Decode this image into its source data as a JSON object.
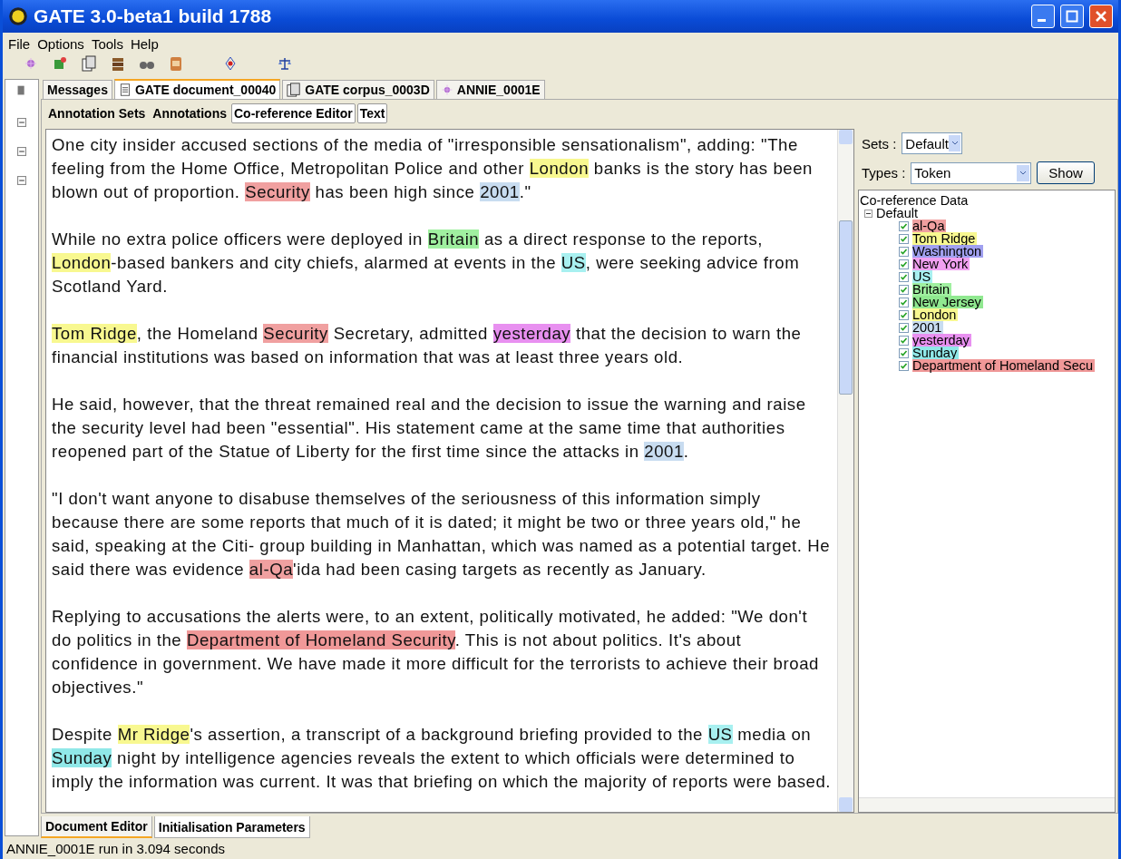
{
  "window": {
    "title": "GATE 3.0-beta1 build 1788"
  },
  "menu": [
    "File",
    "Options",
    "Tools",
    "Help"
  ],
  "resource_tabs": [
    {
      "label": "Messages",
      "kind": "plain",
      "selected": false
    },
    {
      "label": "GATE document_00040",
      "kind": "document",
      "selected": true
    },
    {
      "label": "GATE corpus_0003D",
      "kind": "corpus",
      "selected": false
    },
    {
      "label": "ANNIE_0001E",
      "kind": "application",
      "selected": false
    }
  ],
  "view_buttons": [
    {
      "label": "Annotation Sets",
      "selected": false
    },
    {
      "label": "Annotations",
      "selected": false
    },
    {
      "label": "Co-reference Editor",
      "selected": true
    },
    {
      "label": "Text",
      "selected": true
    }
  ],
  "document": {
    "paragraphs": [
      [
        {
          "text": "One city insider accused sections of the media of \"irresponsible sensationalism\", adding: \"The feeling from the Home Office, Metropolitan Police and other "
        },
        {
          "text": "London",
          "color": "#f8f890"
        },
        {
          "text": " banks is the story has been blown out of proportion. "
        },
        {
          "text": "Security",
          "color": "#f0a0a0"
        },
        {
          "text": " has been high since "
        },
        {
          "text": "2001",
          "color": "#c8dcf0"
        },
        {
          "text": ".\""
        }
      ],
      [
        {
          "text": "While no extra police officers were deployed in "
        },
        {
          "text": "Britain",
          "color": "#a0f0a0"
        },
        {
          "text": " as a direct response to the reports, "
        },
        {
          "text": "London",
          "color": "#f8f890"
        },
        {
          "text": "-based bankers and city chiefs, alarmed at events in the "
        },
        {
          "text": "US",
          "color": "#a8f0f0"
        },
        {
          "text": ", were seeking advice from Scotland Yard."
        }
      ],
      [
        {
          "text": "Tom Ridge",
          "color": "#f8f890"
        },
        {
          "text": ", the Homeland "
        },
        {
          "text": "Security",
          "color": "#f0a0a0"
        },
        {
          "text": " Secretary, admitted "
        },
        {
          "text": "yesterday",
          "color": "#e890f0"
        },
        {
          "text": " that the decision to warn the financial institutions was based on information that was at least three years old."
        }
      ],
      [
        {
          "text": "He said, however, that the threat remained real and the decision to issue the warning and raise the security level had been \"essential\". His statement came at the same time that authorities reopened part of the Statue of Liberty for the first time since the attacks in "
        },
        {
          "text": "2001",
          "color": "#c8dcf0"
        },
        {
          "text": "."
        }
      ],
      [
        {
          "text": "\"I don't want anyone to disabuse themselves of the seriousness of this information simply because there are some reports that much of it is dated; it might be two or three years old,\" he said, speaking at the Citi- group building in Manhattan, which was named as a potential target. He said there was evidence "
        },
        {
          "text": "al-Qa",
          "color": "#f0a0a0"
        },
        {
          "text": "'ida had been casing targets as recently as January."
        }
      ],
      [
        {
          "text": "Replying to accusations the alerts were, to an extent, politically motivated, he added: \"We don't do politics in the "
        },
        {
          "text": "Department of Homeland Security",
          "color": "#f09898"
        },
        {
          "text": ". This is not about politics. It's about confidence in government. We have made it more difficult for the terrorists to achieve their broad objectives.\""
        }
      ],
      [
        {
          "text": "Despite "
        },
        {
          "text": "Mr Ridge",
          "color": "#f8f890"
        },
        {
          "text": "'s assertion, a transcript of a background briefing provided to the "
        },
        {
          "text": "US",
          "color": "#a8f0f0"
        },
        {
          "text": " media on "
        },
        {
          "text": "Sunday",
          "color": "#90e8e8"
        },
        {
          "text": " night by intelligence agencies reveals the extent to which officials were determined to imply the information was current. It was that briefing on which the majority of reports were based."
        }
      ]
    ]
  },
  "coref_panel": {
    "sets_label": "Sets :",
    "sets_value": "Default",
    "types_label": "Types :",
    "types_value": "Token",
    "show_button": "Show",
    "tree": {
      "label": "Co-reference Data",
      "children": [
        {
          "label": "Default",
          "expanded": true,
          "children": [
            {
              "label": "al-Qa",
              "checked": true,
              "color": "#f0a0a0"
            },
            {
              "label": "Tom Ridge",
              "checked": true,
              "color": "#f8f890"
            },
            {
              "label": "Washington",
              "checked": true,
              "color": "#a0a0f0"
            },
            {
              "label": "New York",
              "checked": true,
              "color": "#f0a0f0"
            },
            {
              "label": "US",
              "checked": true,
              "color": "#a8f0f0"
            },
            {
              "label": "Britain",
              "checked": true,
              "color": "#a0f0a0"
            },
            {
              "label": "New Jersey",
              "checked": true,
              "color": "#90e890"
            },
            {
              "label": "London",
              "checked": true,
              "color": "#f8f890"
            },
            {
              "label": "2001",
              "checked": true,
              "color": "#c8dcf0"
            },
            {
              "label": "yesterday",
              "checked": true,
              "color": "#e890f0"
            },
            {
              "label": "Sunday",
              "checked": true,
              "color": "#90e8e8"
            },
            {
              "label": "Department of Homeland Secu",
              "checked": true,
              "color": "#f09898"
            }
          ]
        }
      ]
    }
  },
  "bottom_tabs": [
    {
      "label": "Document Editor",
      "selected": true
    },
    {
      "label": "Initialisation Parameters",
      "selected": false
    }
  ],
  "status_bar": "ANNIE_0001E run in 3.094 seconds"
}
